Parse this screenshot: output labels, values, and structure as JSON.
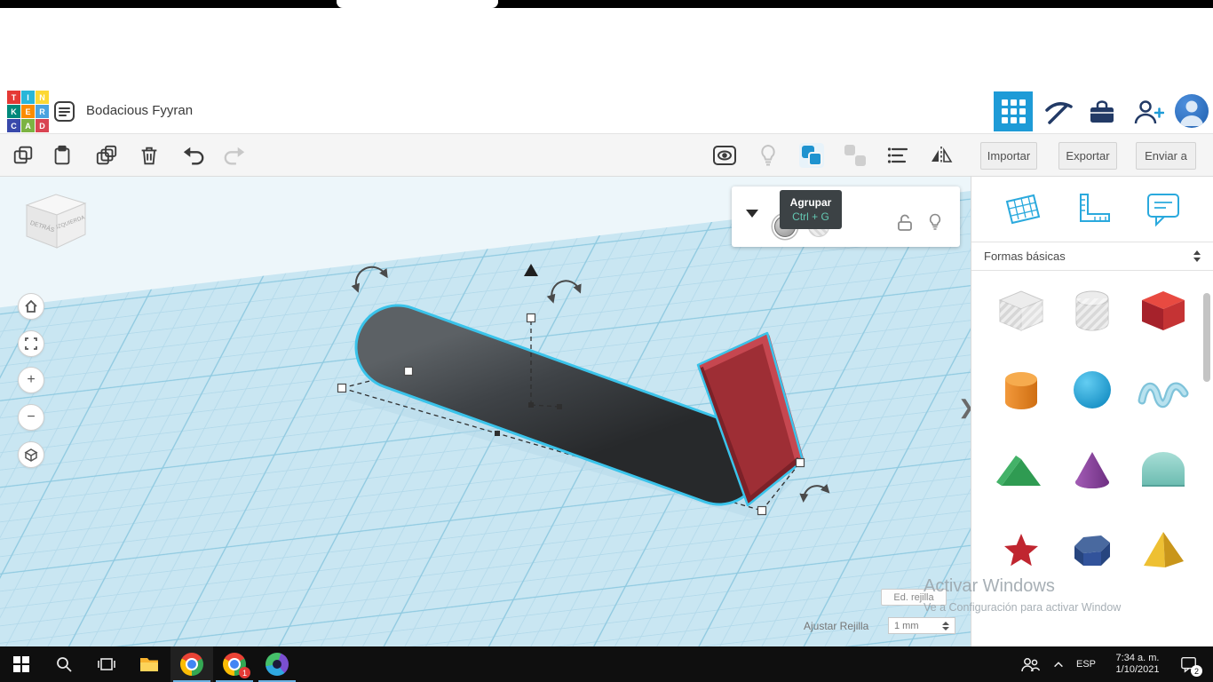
{
  "header": {
    "title": "Bodacious Fyyran",
    "logo_letters": [
      "T",
      "I",
      "N",
      "K",
      "E",
      "R",
      "C",
      "A",
      "D"
    ]
  },
  "toolbar": {
    "import_label": "Importar",
    "export_label": "Exportar",
    "send_to_label": "Enviar a"
  },
  "group_tooltip": {
    "label": "Agrupar",
    "shortcut": "Ctrl + G"
  },
  "view_cube": {
    "back_label": "DETRÁS",
    "left_label": "IZQUIERDA"
  },
  "shapes_panel": {
    "category_label": "Formas básicas",
    "shape_names": [
      "transparent-box",
      "transparent-cylinder",
      "box",
      "cylinder",
      "sphere",
      "scribble",
      "roof",
      "cone",
      "round-roof",
      "star",
      "polygon",
      "pyramid"
    ]
  },
  "grid_controls": {
    "edit_grid_label": "Ed. rejilla",
    "snap_label": "Ajustar Rejilla",
    "snap_value": "1 mm"
  },
  "watermark": {
    "line1": "Activar Windows",
    "line2": "Ve a Configuración para activar Window"
  },
  "taskbar": {
    "language": "ESP",
    "time": "7:34 a. m.",
    "date": "1/10/2021",
    "chrome_badge": "1",
    "tray_badge": "2"
  },
  "colors": {
    "accent_blue": "#1e9bd7",
    "selection_cyan": "#3ac3ea",
    "tooltip_bg": "#3c4245",
    "tooltip_shortcut": "#63c7b2"
  }
}
